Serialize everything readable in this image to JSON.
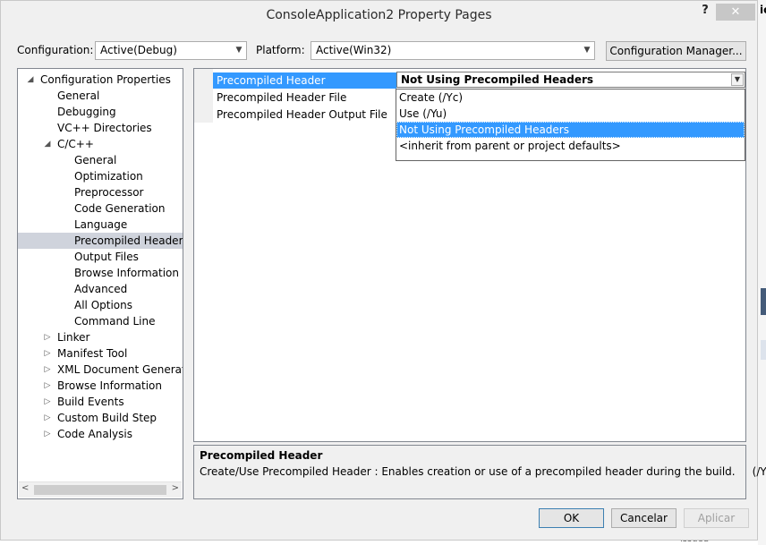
{
  "window": {
    "title": "ConsoleApplication2 Property Pages",
    "help_label": "?",
    "close_label": "✕"
  },
  "config_bar": {
    "configuration_label": "Configuration:",
    "configuration_value": "Active(Debug)",
    "platform_label": "Platform:",
    "platform_value": "Active(Win32)",
    "manager_button": "Configuration Manager..."
  },
  "tree": {
    "items": [
      {
        "label": "Configuration Properties",
        "glyph": "◢"
      },
      {
        "label": "General",
        "glyph": ""
      },
      {
        "label": "Debugging",
        "glyph": ""
      },
      {
        "label": "VC++ Directories",
        "glyph": ""
      },
      {
        "label": "C/C++",
        "glyph": "◢"
      },
      {
        "label": "General",
        "glyph": ""
      },
      {
        "label": "Optimization",
        "glyph": ""
      },
      {
        "label": "Preprocessor",
        "glyph": ""
      },
      {
        "label": "Code Generation",
        "glyph": ""
      },
      {
        "label": "Language",
        "glyph": ""
      },
      {
        "label": "Precompiled Headers",
        "glyph": ""
      },
      {
        "label": "Output Files",
        "glyph": ""
      },
      {
        "label": "Browse Information",
        "glyph": ""
      },
      {
        "label": "Advanced",
        "glyph": ""
      },
      {
        "label": "All Options",
        "glyph": ""
      },
      {
        "label": "Command Line",
        "glyph": ""
      },
      {
        "label": "Linker",
        "glyph": "▷"
      },
      {
        "label": "Manifest Tool",
        "glyph": "▷"
      },
      {
        "label": "XML Document Generator",
        "glyph": "▷"
      },
      {
        "label": "Browse Information",
        "glyph": "▷"
      },
      {
        "label": "Build Events",
        "glyph": "▷"
      },
      {
        "label": "Custom Build Step",
        "glyph": "▷"
      },
      {
        "label": "Code Analysis",
        "glyph": "▷"
      }
    ],
    "selected": "Precompiled Headers",
    "scroll_left": "<",
    "scroll_right": ">"
  },
  "grid": {
    "rows": [
      {
        "name": "Precompiled Header",
        "value": "Not Using Precompiled Headers"
      },
      {
        "name": "Precompiled Header File",
        "value": ""
      },
      {
        "name": "Precompiled Header Output File",
        "value": ""
      }
    ],
    "dropdown_arrow": "▼"
  },
  "dropdown": {
    "options": [
      "Create (/Yc)",
      "Use (/Yu)",
      "Not Using Precompiled Headers",
      "<inherit from parent or project defaults>"
    ],
    "selected": "Not Using Precompiled Headers"
  },
  "description": {
    "title": "Precompiled Header",
    "text": "Create/Use Precompiled Header : Enables creation or use of a precompiled header during the build.     (/Yc, /Yu)"
  },
  "buttons": {
    "ok": "OK",
    "cancel": "Cancelar",
    "apply": "Aplicar"
  },
  "background_fragments": {
    "top_right": "ic",
    "bottom_right": "issued"
  }
}
